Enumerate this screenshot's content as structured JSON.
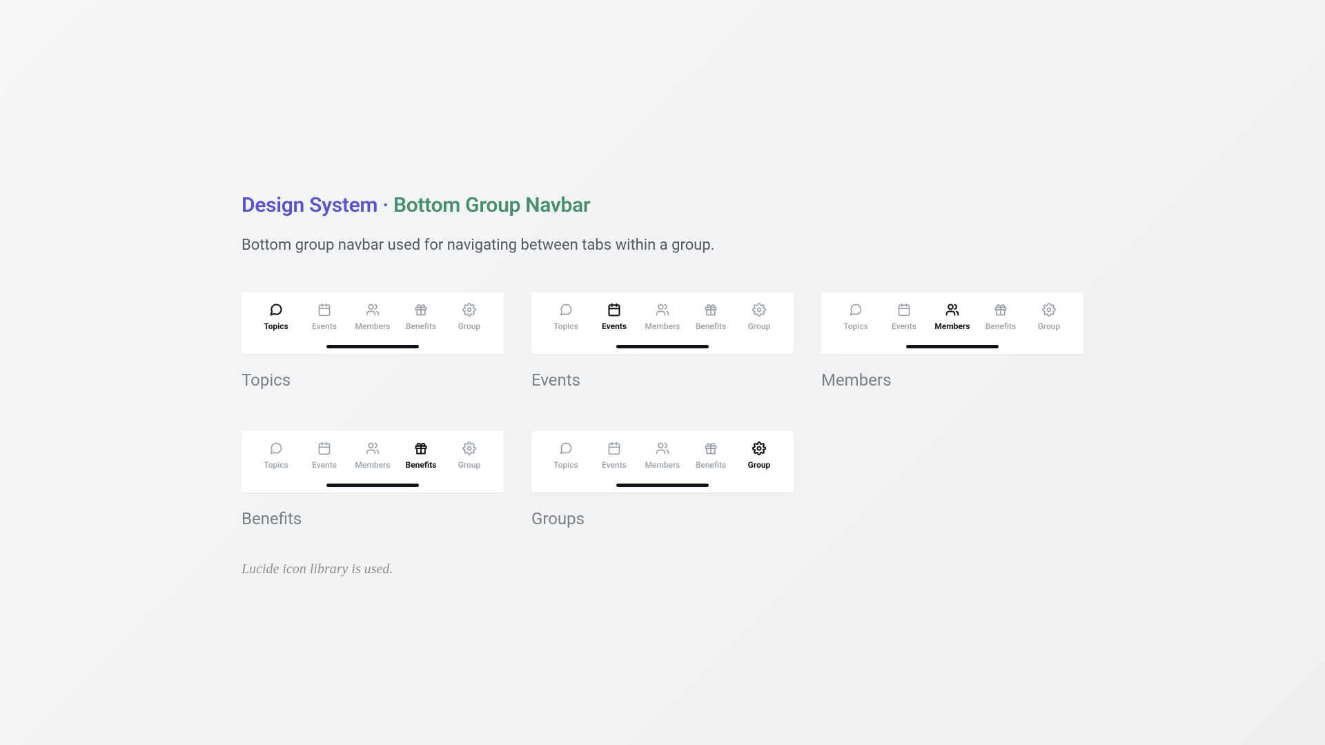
{
  "title_part1": "Design System · ",
  "title_part2": "Bottom Group Navbar",
  "subtitle": "Bottom group navbar used for navigating between tabs within a group.",
  "tabs": {
    "topics": {
      "label": "Topics",
      "icon": "message"
    },
    "events": {
      "label": "Events",
      "icon": "calendar"
    },
    "members": {
      "label": "Members",
      "icon": "users"
    },
    "benefits": {
      "label": "Benefits",
      "icon": "gift"
    },
    "group": {
      "label": "Group",
      "icon": "settings"
    }
  },
  "variants": [
    {
      "caption": "Topics",
      "active": "topics"
    },
    {
      "caption": "Events",
      "active": "events"
    },
    {
      "caption": "Members",
      "active": "members"
    },
    {
      "caption": "Benefits",
      "active": "benefits"
    },
    {
      "caption": "Groups",
      "active": "group"
    }
  ],
  "footnote": "Lucide icon library is used."
}
